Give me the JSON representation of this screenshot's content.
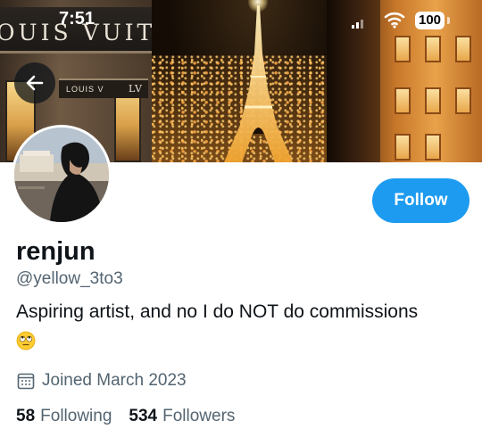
{
  "status_bar": {
    "time": "7:51",
    "battery": "100"
  },
  "banner": {
    "store_sign": "OUIS VUITTON",
    "store_sign_lower": "LOUIS V",
    "store_sign_monogram": "LV"
  },
  "profile": {
    "display_name": "renjun",
    "handle": "@yellow_3to3",
    "bio": "Aspiring artist, and no I do NOT do commissions",
    "bio_emoji": "face-with-rolling-eyes",
    "joined": "Joined March 2023",
    "following_count": "58",
    "following_label": "Following",
    "followers_count": "534",
    "followers_label": "Followers"
  },
  "actions": {
    "follow_label": "Follow"
  },
  "colors": {
    "accent": "#1d9bf0",
    "primary_text": "#0f1419",
    "secondary_text": "#536471"
  },
  "icons": {
    "back": "arrow-left-icon",
    "calendar": "calendar-icon",
    "wifi": "wifi-icon",
    "signal": "cellular-signal-icon"
  }
}
